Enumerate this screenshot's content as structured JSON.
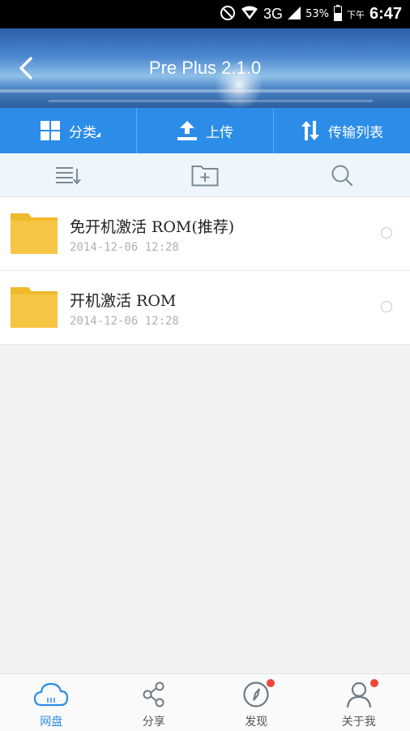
{
  "status_bar": {
    "network": "3G",
    "battery": "53%",
    "time_prefix": "下午",
    "time": "6:47"
  },
  "header": {
    "title": "Pre Plus 2.1.0"
  },
  "actions": [
    {
      "label": "分类",
      "icon": "grid-icon"
    },
    {
      "label": "上传",
      "icon": "upload-icon"
    },
    {
      "label": "传输列表",
      "icon": "transfer-icon"
    }
  ],
  "toolbar": {
    "icons": [
      "sort-list-icon",
      "new-folder-icon",
      "search-icon"
    ]
  },
  "files": [
    {
      "name": "免开机激活 ROM(推荐)",
      "date": "2014-12-06 12:28"
    },
    {
      "name": "开机激活 ROM",
      "date": "2014-12-06 12:28"
    }
  ],
  "bottom_nav": [
    {
      "label": "网盘",
      "icon": "cloud-icon",
      "active": true
    },
    {
      "label": "分享",
      "icon": "share-icon",
      "active": false
    },
    {
      "label": "发现",
      "icon": "compass-icon",
      "active": false,
      "badge": true
    },
    {
      "label": "关于我",
      "icon": "user-icon",
      "active": false,
      "badge": true
    }
  ],
  "colors": {
    "accent": "#2c8de8",
    "folder": "#f7c544",
    "badge": "#f0453a"
  }
}
